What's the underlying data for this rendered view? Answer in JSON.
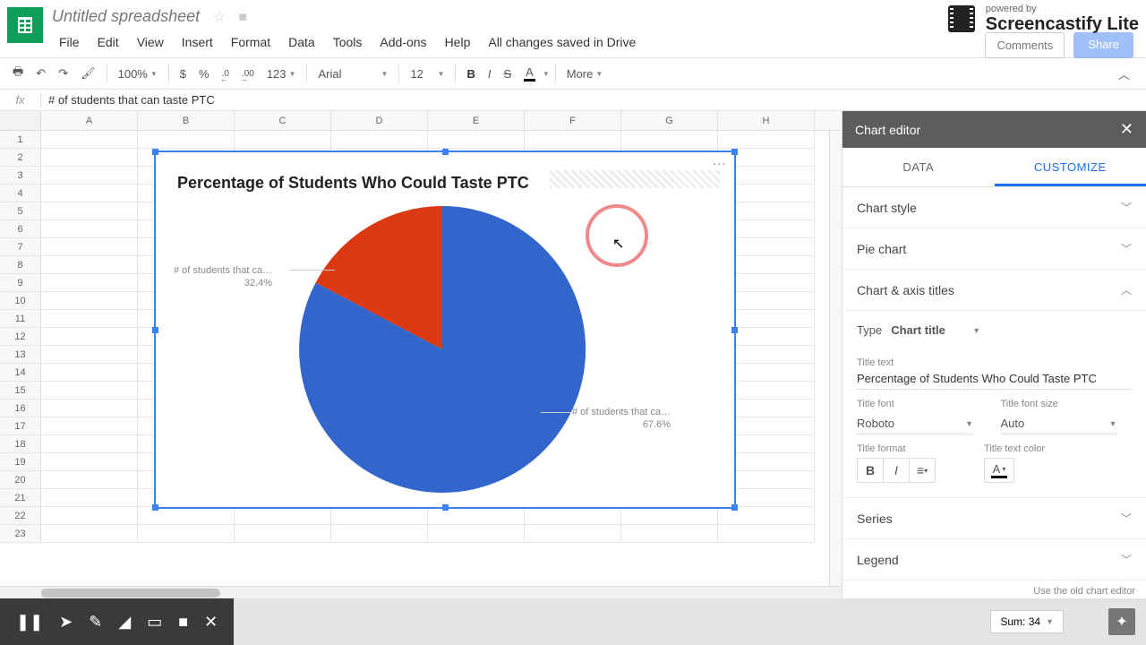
{
  "doc": {
    "title": "Untitled spreadsheet",
    "save_status": "All changes saved in Drive"
  },
  "menu": {
    "file": "File",
    "edit": "Edit",
    "view": "View",
    "insert": "Insert",
    "format": "Format",
    "data": "Data",
    "tools": "Tools",
    "addons": "Add-ons",
    "help": "Help"
  },
  "toolbar": {
    "zoom": "100%",
    "currency": "$",
    "percent": "%",
    "dec_dec": ".0",
    "dec_inc": ".00",
    "num": "123",
    "font": "Arial",
    "size": "12",
    "bold": "B",
    "italic": "I",
    "strike": "S",
    "more": "More"
  },
  "fx": {
    "label": "fx",
    "value": "# of students that can taste PTC"
  },
  "cols": [
    "A",
    "B",
    "C",
    "D",
    "E",
    "F",
    "G",
    "H"
  ],
  "rows": 23,
  "chart_data": {
    "type": "pie",
    "title": "Percentage of Students Who Could Taste PTC",
    "series": [
      {
        "name": "# of students that can taste PTC",
        "name_trunc": "# of students that ca…",
        "value": 67.6,
        "pct_label": "67.6%",
        "color": "#3366cc"
      },
      {
        "name": "# of students that cannot taste PTC",
        "name_trunc": "# of students that ca…",
        "value": 32.4,
        "pct_label": "32.4%",
        "color": "#dc3912"
      }
    ]
  },
  "sidebar": {
    "title": "Chart editor",
    "tabs": {
      "data": "DATA",
      "customize": "CUSTOMIZE"
    },
    "sections": {
      "chart_style": "Chart style",
      "pie_chart": "Pie chart",
      "chart_axis": "Chart & axis titles",
      "series": "Series",
      "legend": "Legend"
    },
    "type_label": "Type",
    "type_value": "Chart title",
    "title_text_label": "Title text",
    "title_text_value": "Percentage of Students Who Could Taste PTC",
    "title_font_label": "Title font",
    "title_font_value": "Roboto",
    "title_size_label": "Title font size",
    "title_size_value": "Auto",
    "title_format_label": "Title format",
    "title_color_label": "Title text color",
    "old_link": "Use the old chart editor"
  },
  "branding": {
    "powered": "powered by",
    "name": "Screencastify Lite"
  },
  "buttons": {
    "comments": "Comments",
    "share": "Share"
  },
  "bottom": {
    "sum": "Sum: 34"
  }
}
